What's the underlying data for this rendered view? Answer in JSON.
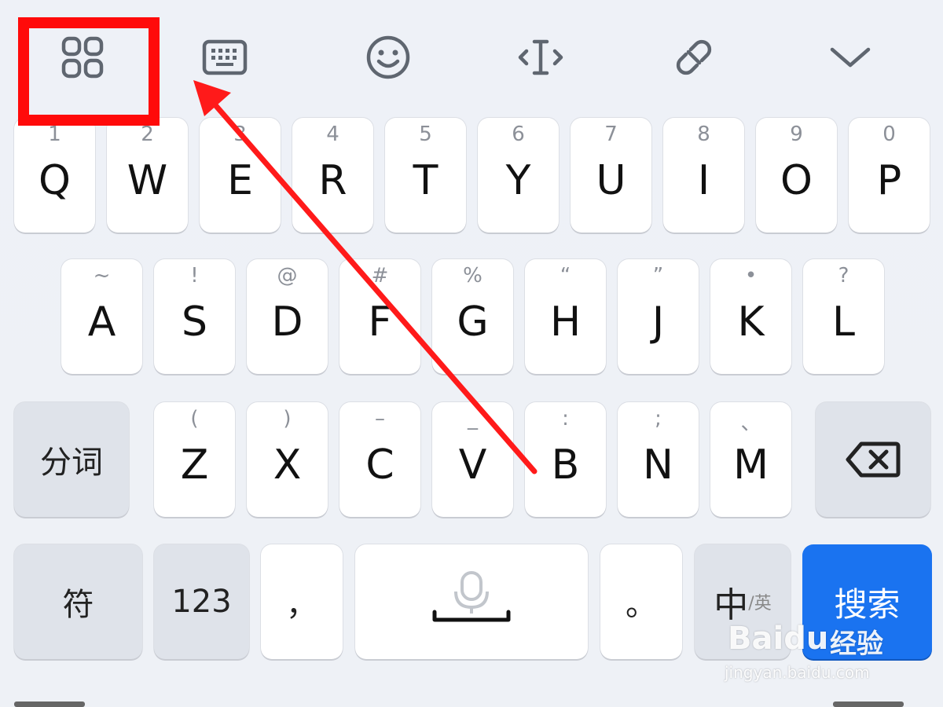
{
  "toolbar": {
    "buttons": [
      {
        "name": "apps-grid-icon"
      },
      {
        "name": "keyboard-icon"
      },
      {
        "name": "emoji-icon"
      },
      {
        "name": "cursor-move-icon"
      },
      {
        "name": "link-icon"
      },
      {
        "name": "collapse-chevron-icon"
      }
    ]
  },
  "keyboard": {
    "row1": [
      {
        "main": "Q",
        "sub": "1"
      },
      {
        "main": "W",
        "sub": "2"
      },
      {
        "main": "E",
        "sub": "3"
      },
      {
        "main": "R",
        "sub": "4"
      },
      {
        "main": "T",
        "sub": "5"
      },
      {
        "main": "Y",
        "sub": "6"
      },
      {
        "main": "U",
        "sub": "7"
      },
      {
        "main": "I",
        "sub": "8"
      },
      {
        "main": "O",
        "sub": "9"
      },
      {
        "main": "P",
        "sub": "0"
      }
    ],
    "row2": [
      {
        "main": "A",
        "sub": "~"
      },
      {
        "main": "S",
        "sub": "!"
      },
      {
        "main": "D",
        "sub": "@"
      },
      {
        "main": "F",
        "sub": "#"
      },
      {
        "main": "G",
        "sub": "%"
      },
      {
        "main": "H",
        "sub": "“"
      },
      {
        "main": "J",
        "sub": "”"
      },
      {
        "main": "K",
        "sub": "•"
      },
      {
        "main": "L",
        "sub": "?"
      }
    ],
    "row3": [
      {
        "main": "Z",
        "sub": "("
      },
      {
        "main": "X",
        "sub": ")"
      },
      {
        "main": "C",
        "sub": "–"
      },
      {
        "main": "V",
        "sub": "_"
      },
      {
        "main": "B",
        "sub": ":"
      },
      {
        "main": "N",
        "sub": ";"
      },
      {
        "main": "M",
        "sub": "、"
      }
    ],
    "segment_label": "分词",
    "symbol_label": "符",
    "numbers_label": "123",
    "comma_label": "，",
    "period_label": "。",
    "lang_main": "中",
    "lang_sub": "/英",
    "search_label": "搜索"
  },
  "colors": {
    "highlight": "#ff0a0a",
    "primary": "#1a73f0"
  },
  "watermark": {
    "logo": "Baidu",
    "jingyan": "经验",
    "url": "jingyan.baidu.com"
  }
}
